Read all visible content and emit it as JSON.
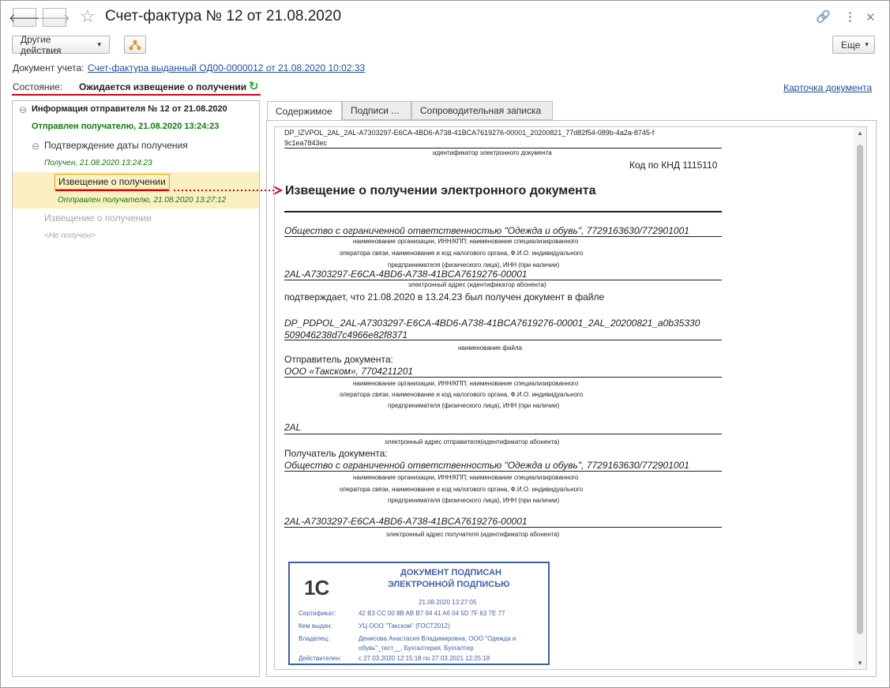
{
  "window": {
    "title": "Счет-фактура № 12 от 21.08.2020"
  },
  "toolbar": {
    "other_actions": "Другие действия",
    "more": "Еще"
  },
  "account_doc": {
    "label": "Документ учета:",
    "link": "Счет-фактура выданный ОД00-0000012 от 21.08.2020 10:02:33"
  },
  "state": {
    "label": "Состояние:",
    "value": "Ожидается извещение о получении",
    "card_link": "Карточка документа"
  },
  "tree": {
    "root": "Информация отправителя № 12 от 21.08.2020",
    "root_status": "Отправлен получателю, 21.08.2020 13:24:23",
    "confirm": "Подтверждение даты получения",
    "confirm_status": "Получен, 21.08.2020 13:24:23",
    "notice1": "Извещение о получении",
    "notice1_status": "Отправлен получателю, 21.08.2020 13:27:12",
    "notice2": "Извещение о получении",
    "notice2_status": "<Не получен>"
  },
  "tabs": [
    "Содержимое",
    "Подписи ...",
    "Сопроводительная записка"
  ],
  "doc": {
    "file_id_1": "DP_IZVPOL_2AL_2AL-A7303297-E6CA-4BD6-A738-41BCA7619276-00001_20200821_77d82f54-089b-4a2a-8745-f",
    "file_id_2": "9c1ea7843ec",
    "file_id_caption": "идентификатор электронного документа",
    "knd": "Код по КНД 1115110",
    "heading": "Извещение о получении электронного документа",
    "org": "Общество с ограниченной ответственностью \"Одежда и обувь\", 7729163630/772901001",
    "org_caption_1": "наименование организации, ИНН/КПП; наименование специализированного",
    "org_caption_2": "оператора связи, наименование и код налогового органа, Ф.И.О. индивидуального",
    "org_caption_3": "предпринимателя (физического лица), ИНН (при наличии)",
    "address": "2AL-A7303297-E6CA-4BD6-A738-41BCA7619276-00001",
    "address_caption": "электронный адрес (идентификатор абонента)",
    "confirm_text": "подтверждает, что 21.08.2020 в 13.24.23 был получен документ в файле",
    "file_name_1": "DP_PDPOL_2AL-A7303297-E6CA-4BD6-A738-41BCA7619276-00001_2AL_20200821_a0b35330",
    "file_name_2": "509046238d7c4966e82f8371",
    "file_name_caption": "наименование файла",
    "sender_label": "Отправитель документа:",
    "sender": "ООО «Такском», 7704211201",
    "sender_caption_1": "наименование организации, ИНН/КПП; наименование специализированного",
    "sender_caption_2": "оператора связи, наименование и код налогового органа, Ф.И.О. индивидуального",
    "sender_caption_3": "предпринимателя (физического лица), ИНН (при наличии)",
    "sender_address": "2AL",
    "sender_address_caption": "электронный адрес отправителя(идентификатор абонента)",
    "recipient_label": "Получатель документа:",
    "recipient": "Общество с ограниченной ответственностью \"Одежда и обувь\", 7729163630/772901001",
    "recipient_caption_1": "наименование организации, ИНН/КПП; наименование специализированного",
    "recipient_caption_2": "оператора связи, наименование и код налогового органа, Ф.И.О. индивидуального",
    "recipient_caption_3": "предпринимателя (физического лица), ИНН (при наличии)",
    "recipient_address": "2AL-A7303297-E6CA-4BD6-A738-41BCA7619276-00001",
    "recipient_address_caption": "электронный адрес получателя (идентификатор абонента)"
  },
  "stamp": {
    "logo": "1С",
    "title_1": "ДОКУМЕНТ ПОДПИСАН",
    "title_2": "ЭЛЕКТРОННОЙ ПОДПИСЬЮ",
    "date": "21.08.2020 13:27:05",
    "cert_label": "Сертификат:",
    "cert": "42 B3 CC 00 8B AB B7 94 41 A6 04 5D 7F 63 7E 77",
    "issuer_label": "Кем выдан:",
    "issuer": "УЦ ООО \"Такском\" (ГОСТ2012)",
    "owner_label": "Владелец:",
    "owner_1": "Денисова Анастасия Владимировна, ООО \"Одежда и",
    "owner_2": "обувь\"_тест__, Бухгалтерия, Бухгалтер",
    "valid_label": "Действителен:",
    "valid": "с 27.03.2020 12:15:18 по 27.03.2021 12:25:18"
  },
  "colors": {
    "link": "#1f4e9c",
    "green": "#0f7a0f",
    "highlight": "#fbf0c2",
    "red": "#d0021b",
    "stamp": "#3e5fae"
  },
  "icons": [
    "back-arrow-icon",
    "forward-arrow-icon",
    "star-icon",
    "link-icon",
    "more-vertical-icon",
    "close-icon",
    "structure-icon",
    "refresh-icon"
  ]
}
